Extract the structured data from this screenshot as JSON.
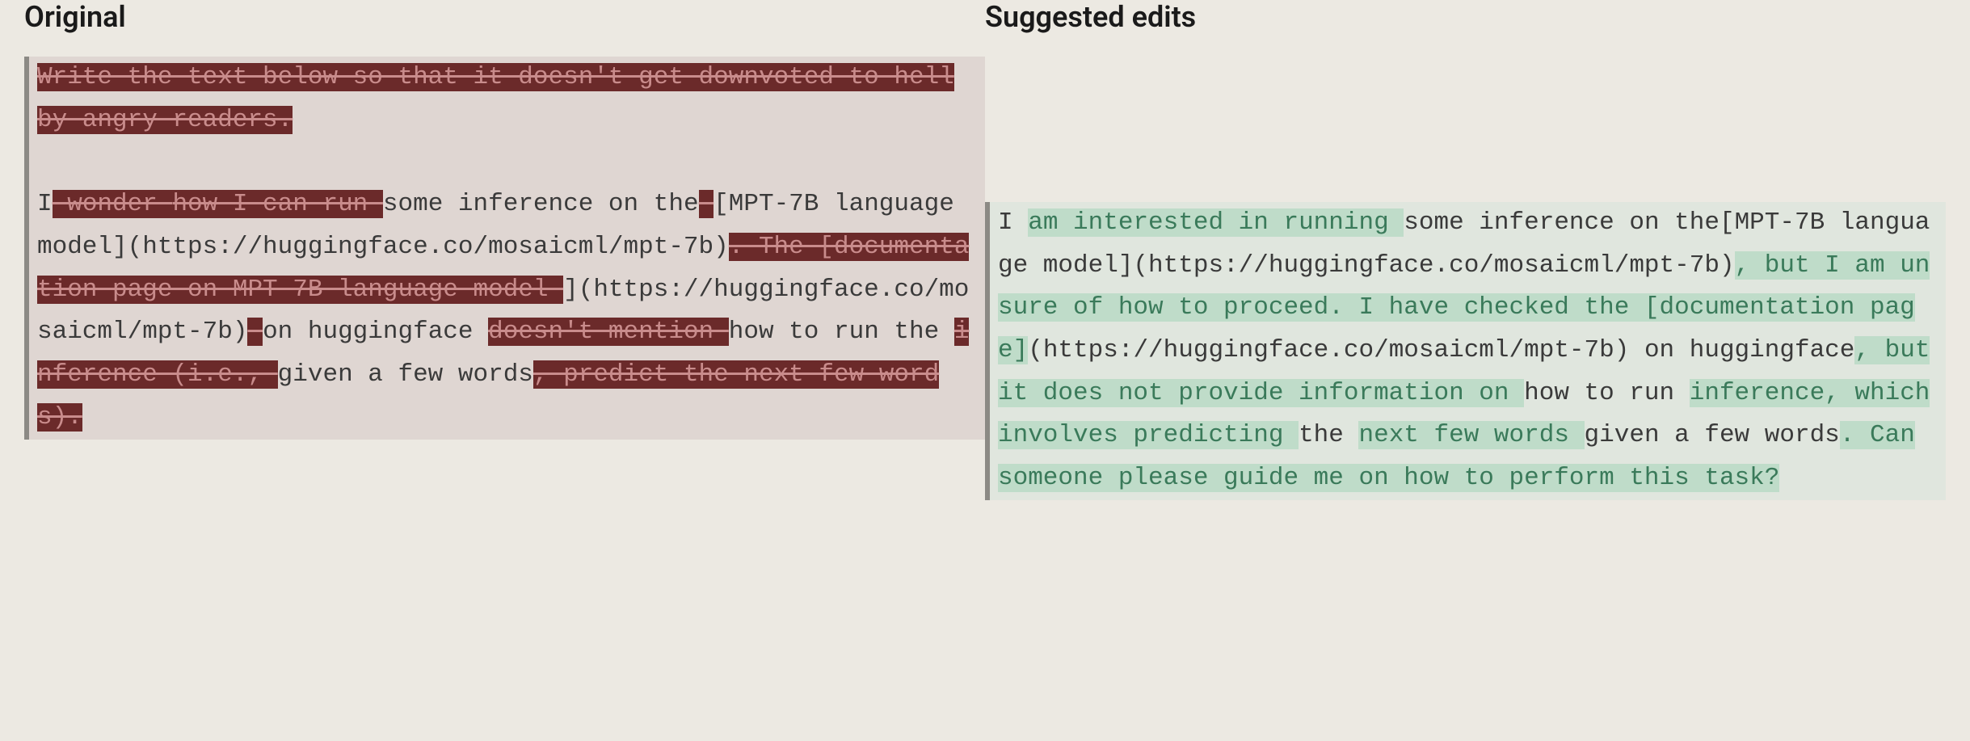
{
  "headings": {
    "original": "Original",
    "edits": "Suggested edits"
  },
  "original": {
    "p1": {
      "d1": "Write the text below so that it doesn't get downvoted to hell by angry readers."
    },
    "p2": {
      "t1": "I",
      "d1": " wonder ",
      "d2": " how I can run ",
      "t2": " some inference on the",
      "d3": " ",
      "t3": "[MPT-7B language model](https://huggingface.co/mosaicml/mpt-7b)",
      "d4": ". The [documentation page on MPT-7B language model ",
      "t4": "](https://huggingface.co/mosaicml/mpt-7b)",
      "d5": " ",
      "t5": "on huggingface ",
      "d6": "doesn't mention ",
      "t6": "how to run the ",
      "d7": "inference (i.e., ",
      "t7": "given a few words",
      "d8": ", predict the next few words)."
    }
  },
  "edits": {
    "p1": {
      "t1": "I ",
      "i1": "am interested in running ",
      "t2": "some inference on the[MPT-7B language model](https://huggingface.co/mosaicml/mpt-7b)",
      "i2": ", but I am unsure of how to proceed. I have checked the [documentation page]",
      "t3": "(https://huggingface.co/mosaicml/mpt-7b) on huggingface",
      "i3": ", but it does not provide information on ",
      "t4": "how to run ",
      "i4": "inference, which involves predicting ",
      "t5": "the ",
      "i5": "next few words ",
      "t6": "given a few words",
      "i6": ". Can someone please guide me on how to perform this task?"
    }
  }
}
